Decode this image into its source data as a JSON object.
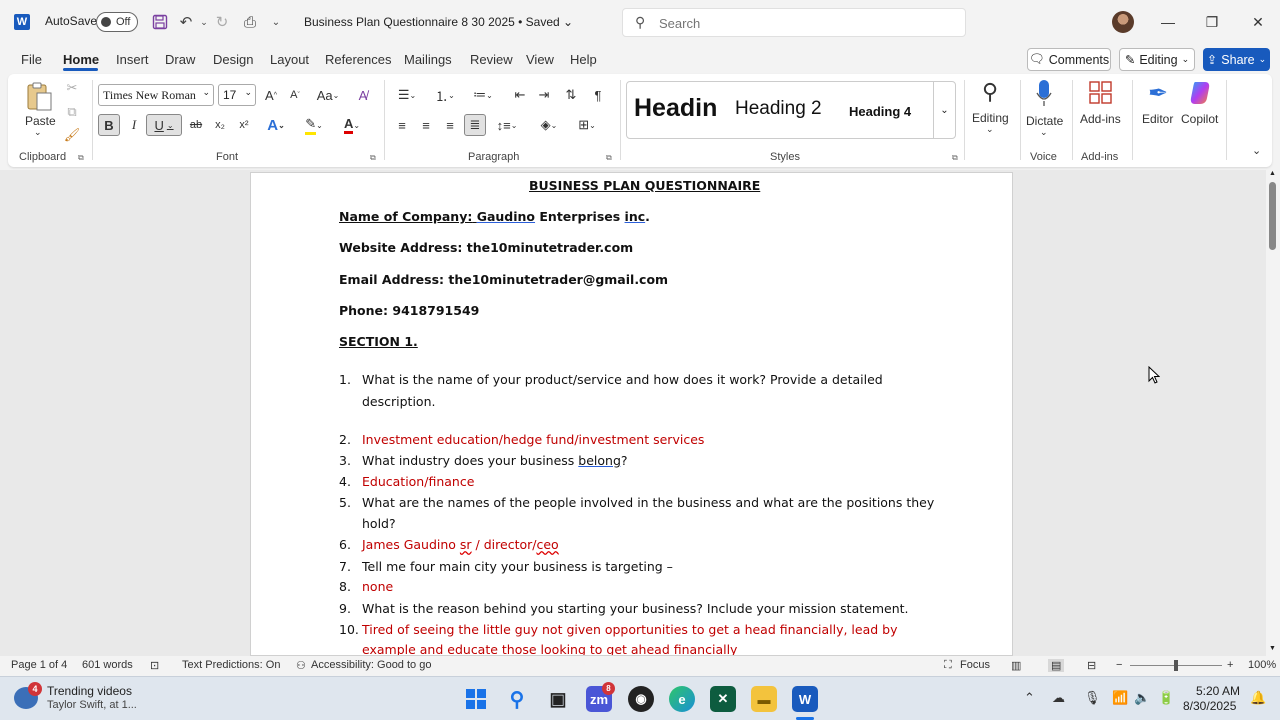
{
  "titlebar": {
    "app_logo": "W",
    "autosave_label": "AutoSave",
    "autosave_state": "Off",
    "doc_title": "Business Plan Questionnaire  8 30 2025  •  Saved  ⌄",
    "search_placeholder": "Search"
  },
  "tabs": [
    "File",
    "Home",
    "Insert",
    "Draw",
    "Design",
    "Layout",
    "References",
    "Mailings",
    "Review",
    "View",
    "Help"
  ],
  "header_buttons": {
    "comments": "Comments",
    "editing": "Editing",
    "share": "Share"
  },
  "ribbon": {
    "clipboard": {
      "paste": "Paste",
      "label": "Clipboard"
    },
    "font": {
      "family": "Times New Roman",
      "size": "17",
      "label": "Font"
    },
    "paragraph": {
      "label": "Paragraph"
    },
    "styles": {
      "items": [
        "Headin",
        "Heading 2",
        "Heading 4"
      ],
      "label": "Styles"
    },
    "editing": "Editing",
    "voice": {
      "dictate": "Dictate",
      "label": "Voice"
    },
    "addins": {
      "button": "Add-ins",
      "label": "Add-ins"
    },
    "editor": "Editor",
    "copilot": "Copilot"
  },
  "document": {
    "title": "BUSINESS PLAN QUESTIONNAIRE",
    "company_label": "Name of Company:",
    "company_name_a": "Gaudino",
    "company_name_b": " Enterprises ",
    "company_name_c": "inc",
    "company_name_d": ".",
    "website": "Website Address: the10minutetrader.com",
    "email": "Email Address:  the10minutetrader@gmail.com",
    "phone": "Phone: 9418791549",
    "section": "SECTION 1.",
    "items": [
      {
        "n": "1.",
        "line1": "What is the name of your product/service and how does it work?  Provide a detailed",
        "line2": "description."
      },
      {
        "n": "2.",
        "text": "Investment education/hedge fund/investment services"
      },
      {
        "n": "3.",
        "text_a": "What industry does your business ",
        "text_b": "belong",
        "text_c": "?"
      },
      {
        "n": "4.",
        "text": "Education/finance"
      },
      {
        "n": "5.",
        "line1": "What are the names of the people involved in the business and what are the positions they",
        "line2": "hold?"
      },
      {
        "n": "6.",
        "text_a": "James Gaudino ",
        "text_b": "sr",
        "text_c": " / director/",
        "text_d": "ceo"
      },
      {
        "n": "7.",
        "text": "Tell me four main city your business is targeting –"
      },
      {
        "n": "8.",
        "text": "none"
      },
      {
        "n": "9.",
        "text": "What is the reason behind you starting your business?  Include your mission statement."
      },
      {
        "n": "10.",
        "line1": "Tired of seeing the little guy not given opportunities to get a head financially, lead by",
        "line2": "example and educate those looking to get ahead financially"
      }
    ]
  },
  "statusbar": {
    "page": "Page 1 of 4",
    "words": "601 words",
    "predictions": "Text Predictions: On",
    "accessibility": "Accessibility: Good to go",
    "focus": "Focus",
    "zoom": "100%"
  },
  "taskbar": {
    "widget_badge": "4",
    "widget_title": "Trending videos",
    "widget_sub": "Taylor Swift, at 1...",
    "zoom_badge": "8",
    "time": "5:20 AM",
    "date": "8/30/2025"
  },
  "colors": {
    "accent": "#185abd",
    "answer_red": "#c00000"
  }
}
